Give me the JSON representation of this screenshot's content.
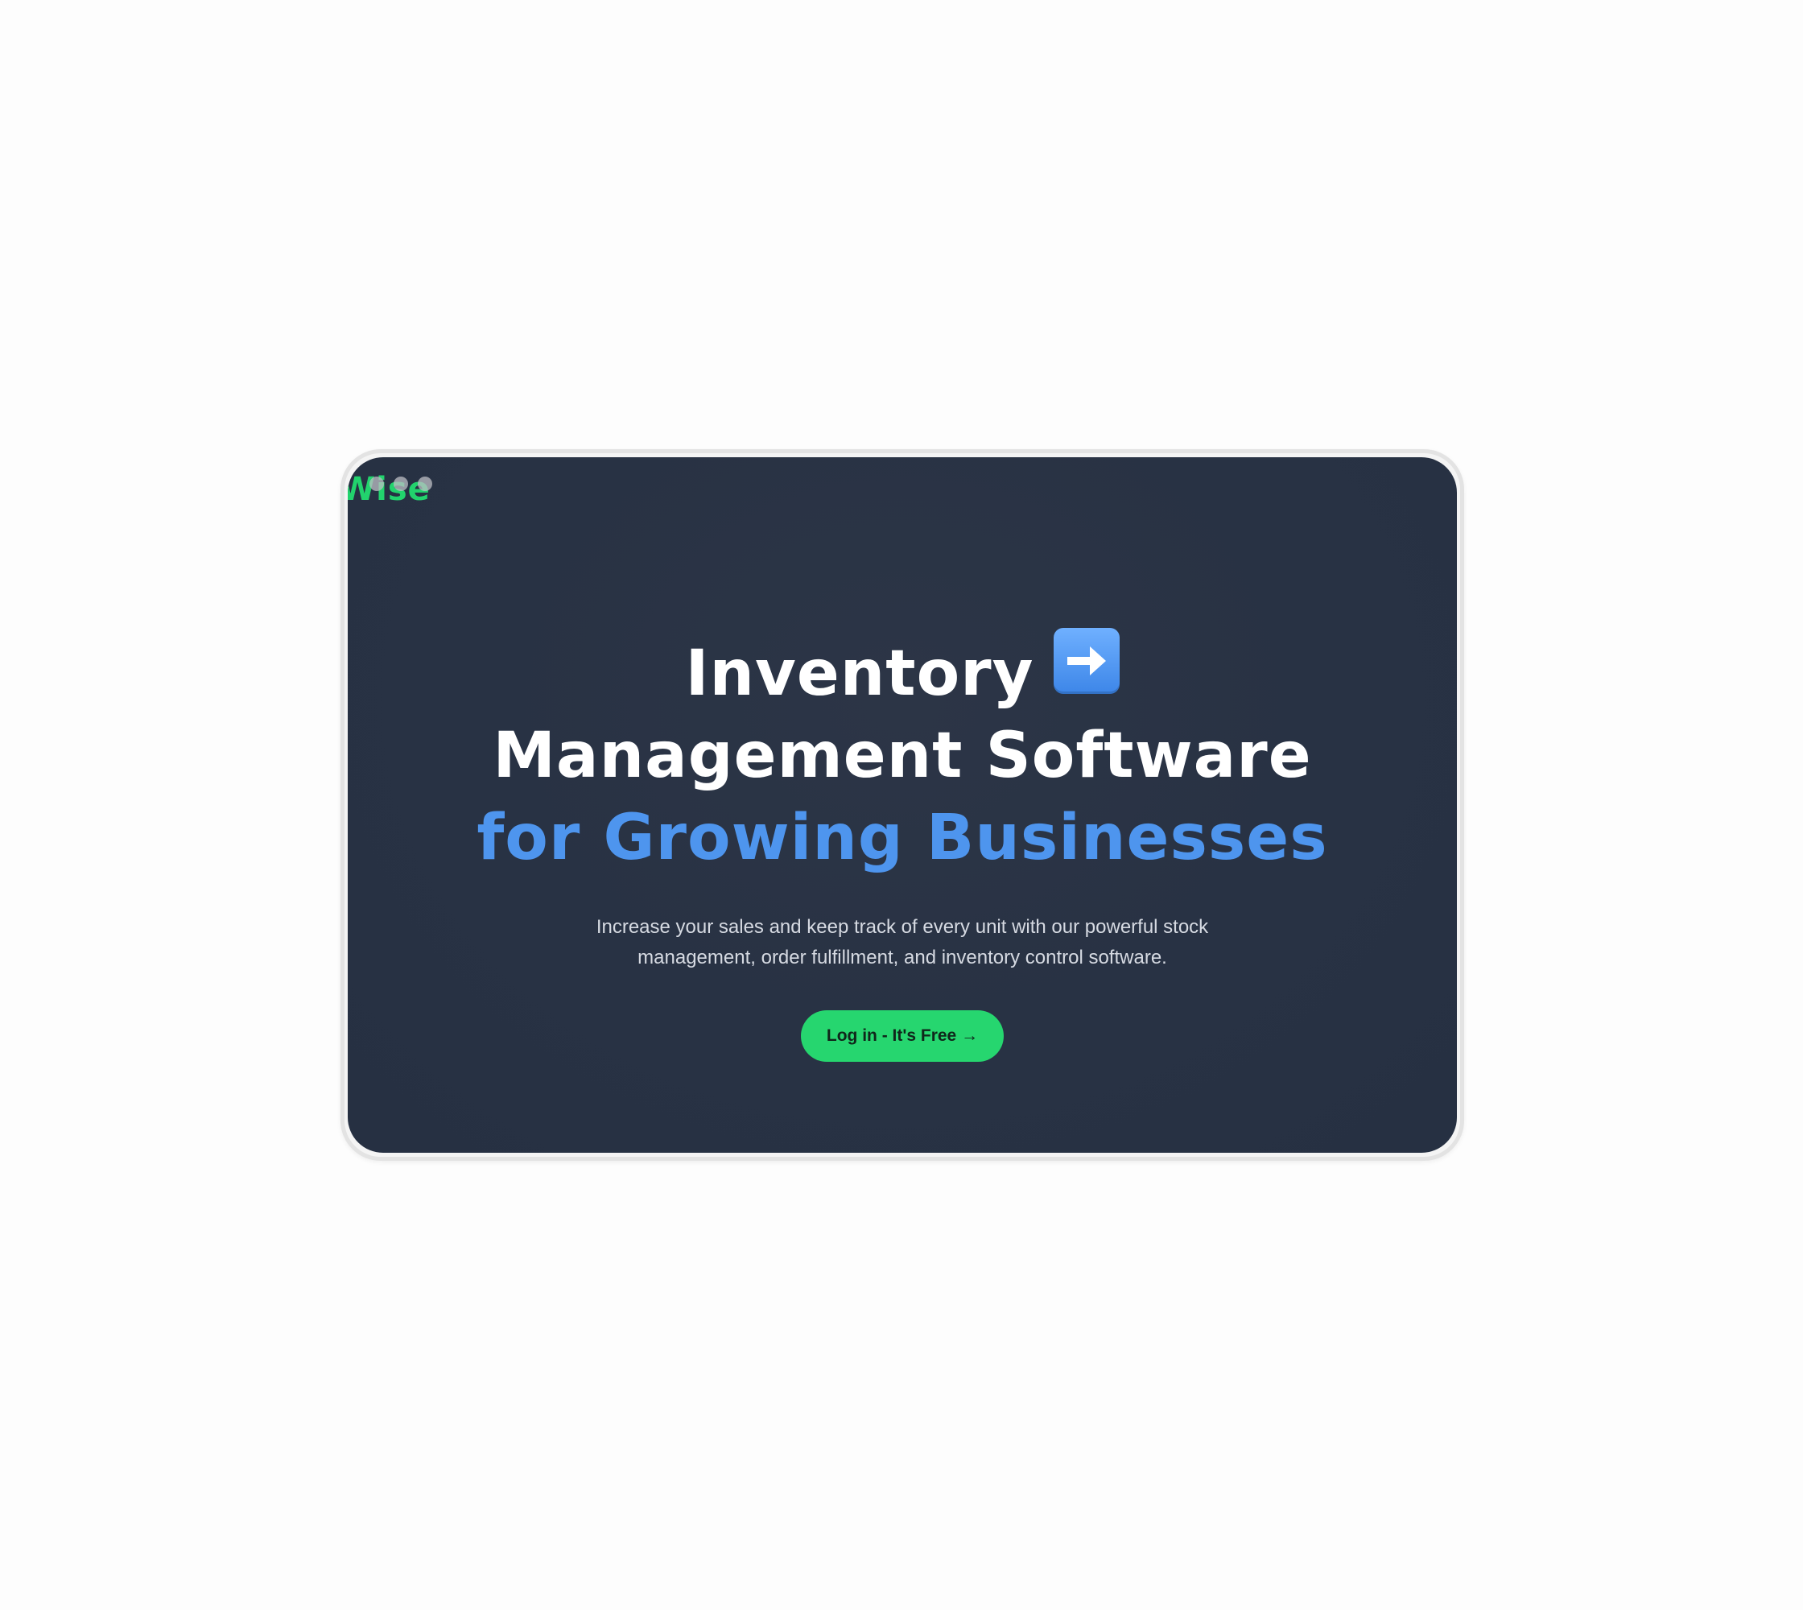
{
  "brand": {
    "logo_text": "Wise",
    "accent_color": "#22d36d"
  },
  "hero": {
    "headline_line1": "Inventory",
    "headline_icon": "right-arrow-icon",
    "headline_line2": "Management Software",
    "headline_line3": "for Growing Businesses",
    "subtitle": "Increase your sales and keep track of every unit with our powerful stock management, order fulfillment, and inventory control software.",
    "cta_label": "Log in - It's Free →",
    "cta_color": "#26d66f",
    "accent_color": "#4e95ee"
  },
  "colors": {
    "background": "#283244",
    "headline": "#ffffff"
  }
}
